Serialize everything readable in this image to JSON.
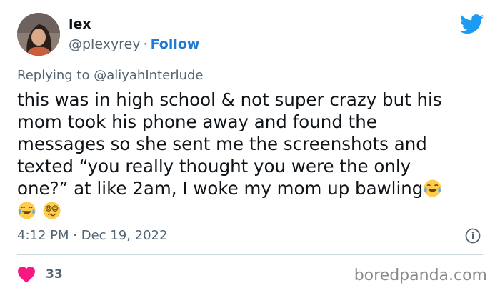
{
  "user": {
    "name": "lex",
    "handle": "@plexyrey",
    "separator": "·",
    "follow_label": "Follow"
  },
  "reply": {
    "prefix": "Replying to",
    "mention": "@aliyahInterlude"
  },
  "tweet": {
    "lines": [
      "this was in high school & not super crazy but his",
      "mom took his phone away and found the",
      "messages so she sent me the screenshots and",
      "texted “you really thought you were the only",
      "one?” at like 2am, I woke my mom up bawling"
    ],
    "trailing_emojis": [
      "face-with-tears-of-joy",
      "face-with-spiral-eyes"
    ]
  },
  "meta": {
    "time": "4:12 PM",
    "separator": "·",
    "date": "Dec 19, 2022"
  },
  "engagement": {
    "likes": "33"
  },
  "watermark": "boredpanda.com",
  "icons": {
    "brand": "twitter-bird-icon",
    "info": "info-icon",
    "like": "heart-icon"
  },
  "colors": {
    "accent": "#1d9bf0",
    "follow": "#1d7ad8",
    "heart": "#f91880",
    "muted": "#536471"
  }
}
